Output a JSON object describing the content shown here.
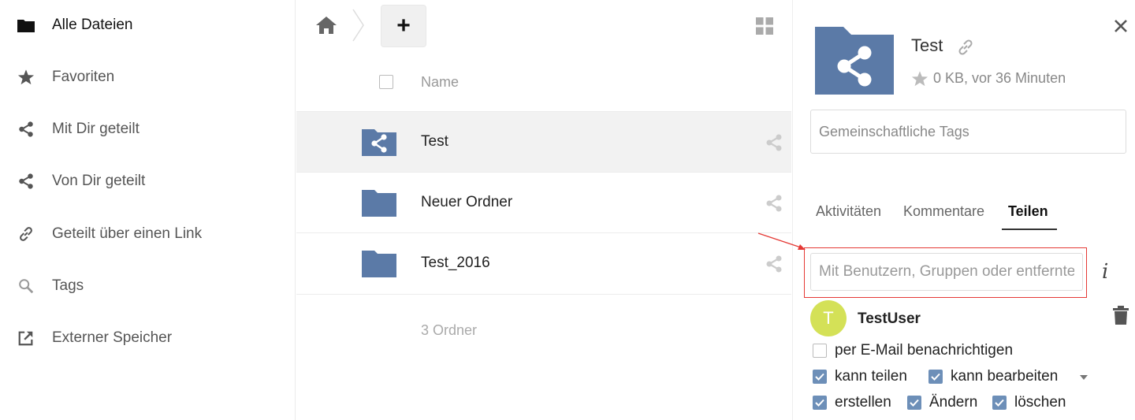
{
  "sidebar": {
    "items": [
      {
        "label": "Alle Dateien"
      },
      {
        "label": "Favoriten"
      },
      {
        "label": "Mit Dir geteilt"
      },
      {
        "label": "Von Dir geteilt"
      },
      {
        "label": "Geteilt über einen Link"
      },
      {
        "label": "Tags"
      },
      {
        "label": "Externer Speicher"
      }
    ]
  },
  "filelist": {
    "add_label": "+",
    "header_name": "Name",
    "rows": [
      {
        "name": "Test"
      },
      {
        "name": "Neuer Ordner"
      },
      {
        "name": "Test_2016"
      }
    ],
    "summary": "3 Ordner"
  },
  "details": {
    "title": "Test",
    "meta": "0 KB, vor 36 Minuten",
    "tags_placeholder": "Gemeinschaftliche Tags",
    "tabs": [
      {
        "label": "Aktivitäten"
      },
      {
        "label": "Kommentare"
      },
      {
        "label": "Teilen"
      }
    ],
    "share_placeholder": "Mit Benutzern, Gruppen oder entfernten Benutzern teilen…",
    "info_label": "i",
    "user": {
      "initial": "T",
      "name": "TestUser"
    },
    "permissions": [
      {
        "label": "per E-Mail benachrichtigen",
        "checked": false
      },
      {
        "label": "kann teilen",
        "checked": true
      },
      {
        "label": "kann bearbeiten",
        "checked": true
      },
      {
        "label": "erstellen",
        "checked": true
      },
      {
        "label": "Ändern",
        "checked": true
      },
      {
        "label": "löschen",
        "checked": true
      }
    ]
  },
  "colors": {
    "folder": "#5b7aa7",
    "checkbox": "#6d8fb8",
    "avatar": "#d4e157",
    "highlight": "#e53935"
  }
}
